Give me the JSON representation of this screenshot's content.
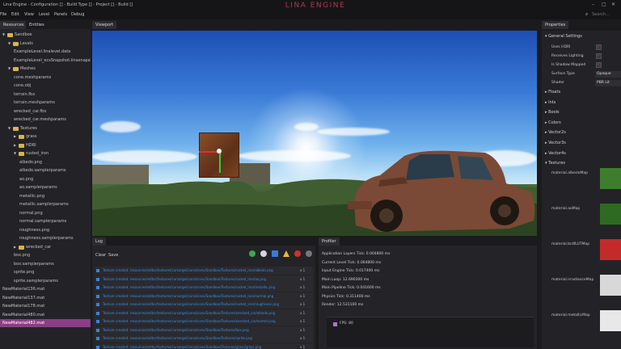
{
  "window": {
    "title": "Lina Engine - Configuration [] - Build Type [] - Project [] - Build []",
    "brand": "LINA ENGINE",
    "minimize": "–",
    "maximize": "□",
    "close": "✕"
  },
  "menu": {
    "items": [
      "File",
      "Edit",
      "View",
      "Level",
      "Panels",
      "Debug"
    ],
    "search_placeholder": "Search..."
  },
  "resources": {
    "tabs": [
      "Resources",
      "Entities"
    ],
    "tree": [
      {
        "label": "Sandbox",
        "indent": 0,
        "folder": true,
        "open": true
      },
      {
        "label": "Levels",
        "indent": 1,
        "folder": true,
        "open": true
      },
      {
        "label": "ExampleLevel.linalevel.data",
        "indent": 2
      },
      {
        "label": "ExampleLevel_ecsSnapshot.linasnapshot",
        "indent": 2
      },
      {
        "label": "Meshes",
        "indent": 1,
        "folder": true,
        "open": true
      },
      {
        "label": "cone.meshparams",
        "indent": 2
      },
      {
        "label": "cone.obj",
        "indent": 2
      },
      {
        "label": "terrain.fbx",
        "indent": 2
      },
      {
        "label": "terrain.meshparams",
        "indent": 2
      },
      {
        "label": "wrecked_car.fbx",
        "indent": 2
      },
      {
        "label": "wrecked_car.meshparams",
        "indent": 2
      },
      {
        "label": "Textures",
        "indent": 1,
        "folder": true,
        "open": true
      },
      {
        "label": "grass",
        "indent": 2,
        "folder": true
      },
      {
        "label": "HDRI",
        "indent": 2,
        "folder": true
      },
      {
        "label": "rusted_iron",
        "indent": 2,
        "folder": true,
        "open": true
      },
      {
        "label": "albedo.png",
        "indent": 3
      },
      {
        "label": "albedo.samplerparams",
        "indent": 3
      },
      {
        "label": "ao.png",
        "indent": 3
      },
      {
        "label": "ao.samplerparams",
        "indent": 3
      },
      {
        "label": "metallic.png",
        "indent": 3
      },
      {
        "label": "metallic.samplerparams",
        "indent": 3
      },
      {
        "label": "normal.png",
        "indent": 3
      },
      {
        "label": "normal.samplerparams",
        "indent": 3
      },
      {
        "label": "roughness.png",
        "indent": 3
      },
      {
        "label": "roughness.samplerparams",
        "indent": 3
      },
      {
        "label": "wrecked_car",
        "indent": 2,
        "folder": true
      },
      {
        "label": "box.png",
        "indent": 2
      },
      {
        "label": "box.samplerparams",
        "indent": 2
      },
      {
        "label": "sprite.png",
        "indent": 2
      },
      {
        "label": "sprite.samplerparams",
        "indent": 2
      },
      {
        "label": "NewMaterial136.mat",
        "indent": 0
      },
      {
        "label": "NewMaterial137.mat",
        "indent": 0
      },
      {
        "label": "NewMaterial178.mat",
        "indent": 0
      },
      {
        "label": "NewMaterial480.mat",
        "indent": 0
      },
      {
        "label": "NewMaterial482.mat",
        "indent": 0,
        "selected": true
      }
    ]
  },
  "viewport": {
    "tab": "Viewport"
  },
  "log": {
    "tab": "Log",
    "clear": "Clear",
    "save": "Save",
    "entries": [
      {
        "text": "Texture created: resources/editor/textures/cursorge/icons/icons/Sandbox/Textures/rusted_iron/albedo.png",
        "count": "x 1"
      },
      {
        "text": "Texture created: resources/editor/textures/cursorge/icons/icons/Sandbox/Textures/rusted_iron/ao.png",
        "count": "x 1"
      },
      {
        "text": "Texture created: resources/editor/textures/cursorge/icons/icons/Sandbox/Textures/rusted_iron/metallic.png",
        "count": "x 1"
      },
      {
        "text": "Texture created: resources/editor/textures/cursorge/icons/icons/Sandbox/Textures/rusted_iron/normal.png",
        "count": "x 1"
      },
      {
        "text": "Texture created: resources/editor/textures/cursorge/icons/icons/Sandbox/Textures/rusted_iron/roughness.png",
        "count": "x 1"
      },
      {
        "text": "Texture created: resources/editor/textures/cursorge/icons/icons/Sandbox/Textures/wrecked_car/albedo.png",
        "count": "x 1"
      },
      {
        "text": "Texture created: resources/editor/textures/cursorge/icons/icons/Sandbox/Textures/wrecked_car/normal.png",
        "count": "x 1"
      },
      {
        "text": "Texture created: resources/editor/textures/cursorge/icons/icons/Sandbox/Textures/box.png",
        "count": "x 1"
      },
      {
        "text": "Texture created: resources/editor/textures/cursorge/icons/icons/Sandbox/Textures/sprite.png",
        "count": "x 1"
      },
      {
        "text": "Texture created: resources/editor/textures/cursorge/icons/icons/Sandbox/Textures/grass/grass.png",
        "count": "x 1"
      }
    ]
  },
  "profiler": {
    "tab": "Profiler",
    "lines": [
      "Application Layers Tick: 0.004800 ms",
      "Current Level Tick: 0.004800 ms",
      "Input Engine Tick: 0.017400 ms",
      "Main Loop: 12.690300 ms",
      "Main Pipeline Tick: 0.041600 ms",
      "Physics Tick: 0.311400 ms",
      "Render: 12.531100 ms"
    ],
    "fps_label": "FPS: 80"
  },
  "properties": {
    "tab": "Properties",
    "general": "General Settings",
    "rows": [
      {
        "label": "Uses HDRI",
        "type": "check"
      },
      {
        "label": "Receives Lighting",
        "type": "check"
      },
      {
        "label": "Is Shadow Mapped",
        "type": "check"
      },
      {
        "label": "Surface Type",
        "type": "dropdown",
        "value": "Opaque"
      },
      {
        "label": "Shader",
        "type": "dropdown",
        "value": "PBR Lit"
      }
    ],
    "sections": [
      "Floats",
      "Ints",
      "Bools",
      "Colors",
      "Vector2s",
      "Vector3s",
      "Vector4s",
      "Textures"
    ],
    "textures": [
      {
        "label": "material.albedoMap",
        "color": "#3f7d2e"
      },
      {
        "label": "material.aoMap",
        "color": "#2e6a22"
      },
      {
        "label": "material.brdfLUTMap",
        "color": "#c42a2a"
      },
      {
        "label": "material.irradianceMap",
        "color": "#d8d8d8"
      },
      {
        "label": "material.metallicMap",
        "color": "#e8e8e8"
      }
    ]
  }
}
